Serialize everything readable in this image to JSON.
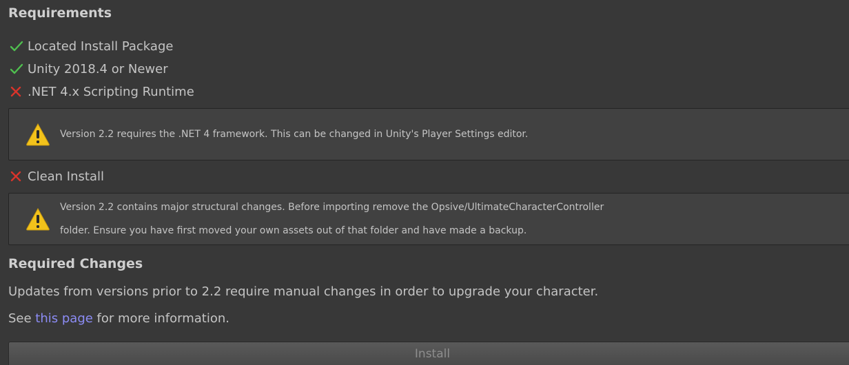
{
  "requirements": {
    "title": "Requirements",
    "items": [
      {
        "label": "Located Install Package",
        "status": "pass"
      },
      {
        "label": "Unity 2018.4 or Newer",
        "status": "pass"
      },
      {
        "label": ".NET 4.x Scripting Runtime",
        "status": "fail"
      },
      {
        "label": "Clean Install",
        "status": "fail"
      }
    ],
    "net_warning": "Version 2.2 requires the .NET 4 framework. This can be changed in Unity's Player Settings editor.",
    "clean_warning_line1": "Version 2.2 contains major structural changes. Before importing remove the Opsive/UltimateCharacterController",
    "clean_warning_line2": "folder. Ensure you have first moved your own assets out of that folder and have made a backup."
  },
  "required_changes": {
    "title": "Required Changes",
    "description": "Updates from versions prior to 2.2 require manual changes in order to upgrade your character.",
    "see_prefix": "See ",
    "link_text": "this page",
    "see_suffix": " for more information."
  },
  "install_button": {
    "label": "Install"
  },
  "icons": {
    "pass": "checkmark-icon",
    "fail": "cross-icon",
    "warning": "warning-triangle-icon"
  },
  "colors": {
    "background": "#383838",
    "pass": "#4fbf4f",
    "fail": "#d9342b",
    "warning": "#f2c21b",
    "link": "#8c8cf5"
  }
}
